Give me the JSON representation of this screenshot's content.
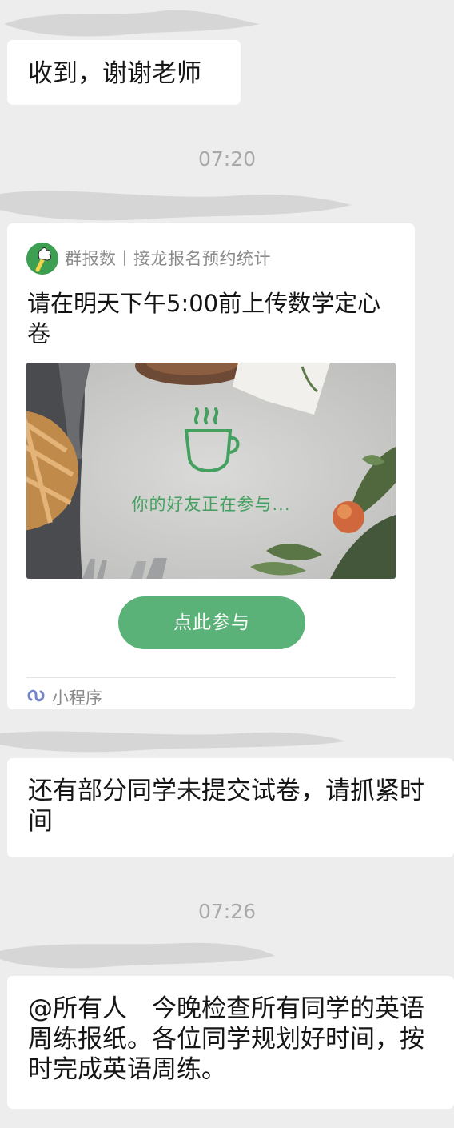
{
  "messages": [
    {
      "type": "text",
      "text": "收到，谢谢老师"
    },
    {
      "type": "time",
      "text": "07:20"
    },
    {
      "type": "mini_program",
      "app_name": "群报数丨接龙报名预约统计",
      "title": "请在明天下午5:00前上传数学定心卷",
      "image_caption": "你的好友正在参与...",
      "button_label": "点此参与",
      "footer_label": "小程序"
    },
    {
      "type": "text",
      "text": "还有部分同学未提交试卷，请抓紧时间"
    },
    {
      "type": "time",
      "text": "07:26"
    },
    {
      "type": "text",
      "text": "@所有人　今晚检查所有同学的英语周练报纸。各位同学规划好时间，按时完成英语周练。"
    }
  ],
  "colors": {
    "background": "#ededed",
    "bubble": "#ffffff",
    "accent_green": "#5bb278",
    "timestamp": "#a8a8a8"
  },
  "icons": [
    "app-logo-icon",
    "coffee-cup-icon",
    "mini-program-icon"
  ]
}
